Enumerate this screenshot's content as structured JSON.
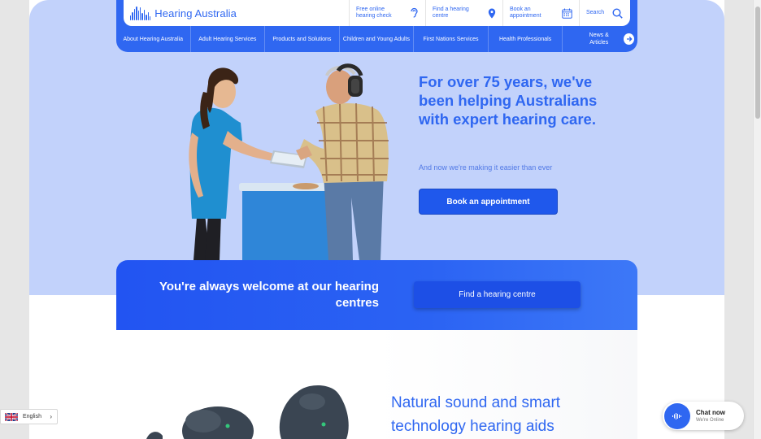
{
  "header": {
    "logo_text": "Hearing Australia",
    "utility": [
      {
        "label": "Free online hearing check",
        "icon": "ear-icon"
      },
      {
        "label": "Find a hearing centre",
        "icon": "map-pin-icon"
      },
      {
        "label": "Book an appointment",
        "icon": "calendar-icon"
      },
      {
        "label": "Search",
        "icon": "search-icon"
      }
    ],
    "nav": [
      "About Hearing Australia",
      "Adult Hearing Services",
      "Products and Solutions",
      "Children and Young Adults",
      "First Nations Services",
      "Health Professionals",
      "News & Articles"
    ]
  },
  "hero": {
    "title": "For over 75 years, we've been helping Australians with expert hearing care.",
    "subtitle": "And now we're making it easier than ever",
    "cta": "Book an appointment"
  },
  "banner": {
    "text": "You're always welcome at our hearing centres",
    "cta": "Find a hearing centre"
  },
  "product": {
    "title": "Natural sound and smart technology hearing aids"
  },
  "language": {
    "selected": "English"
  },
  "chat": {
    "title": "Chat now",
    "status": "We're Online"
  },
  "colors": {
    "brand_blue": "#2f67f1",
    "hero_bg": "#c2d2fb",
    "banner_blue": "#2254f2"
  }
}
